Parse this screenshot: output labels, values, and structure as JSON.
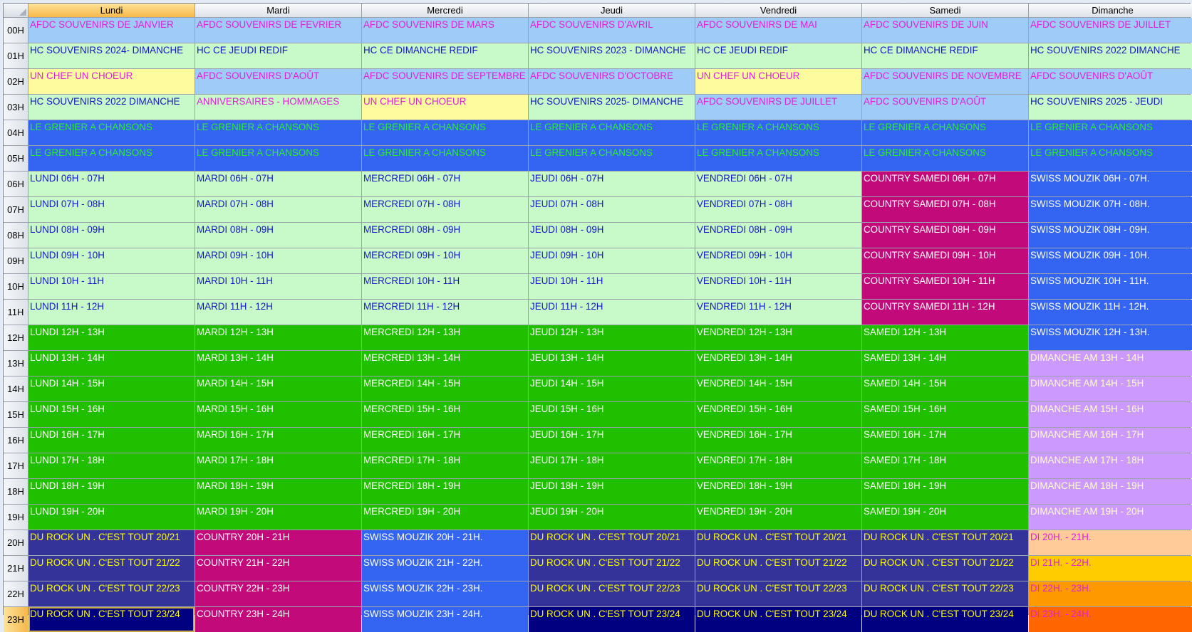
{
  "days": [
    "Lundi",
    "Mardi",
    "Mercredi",
    "Jeudi",
    "Vendredi",
    "Samedi",
    "Dimanche"
  ],
  "hours": [
    "00H",
    "01H",
    "02H",
    "03H",
    "04H",
    "05H",
    "06H",
    "07H",
    "08H",
    "09H",
    "10H",
    "11H",
    "12H",
    "13H",
    "14H",
    "15H",
    "16H",
    "17H",
    "18H",
    "19H",
    "20H",
    "21H",
    "22H",
    "23H"
  ],
  "selected": {
    "day": 0,
    "hour": 23
  },
  "styles": {
    "afdc": {
      "bg": "#9fcbf8",
      "fg": "#e020d8"
    },
    "hc": {
      "bg": "#c8f9c8",
      "fg": "#1616c8"
    },
    "hc_pink": {
      "bg": "#c8f9c8",
      "fg": "#e020d8"
    },
    "chef": {
      "bg": "#fdfb9e",
      "fg": "#e020d8"
    },
    "grenier": {
      "bg": "#3465f2",
      "fg": "#2cee2c"
    },
    "lightgreen": {
      "bg": "#c8f9c8",
      "fg": "#1616c8"
    },
    "green": {
      "bg": "#20c000",
      "fg": "#ffffff"
    },
    "country": {
      "bg": "#c30a7a",
      "fg": "#ffffff"
    },
    "swiss": {
      "bg": "#3465f2",
      "fg": "#ffffff"
    },
    "lavender": {
      "bg": "#cc99ff",
      "fg": "#ffffcc"
    },
    "rock": {
      "bg": "#333399",
      "fg": "#ffff00"
    },
    "rocknavy": {
      "bg": "#000080",
      "fg": "#ffff00"
    },
    "di20": {
      "bg": "#ffcc99",
      "fg": "#e020d8"
    },
    "di21": {
      "bg": "#ffcc00",
      "fg": "#e020d8"
    },
    "di22": {
      "bg": "#ff9900",
      "fg": "#e020d8"
    },
    "di23": {
      "bg": "#ff6600",
      "fg": "#e020d8"
    }
  },
  "rows": [
    [
      {
        "text": "AFDC SOUVENIRS DE JANVIER",
        "style": "afdc"
      },
      {
        "text": "AFDC SOUVENIRS DE FEVRIER",
        "style": "afdc"
      },
      {
        "text": "AFDC SOUVENIRS DE MARS",
        "style": "afdc"
      },
      {
        "text": "AFDC SOUVENIRS D'AVRIL",
        "style": "afdc"
      },
      {
        "text": "AFDC SOUVENIRS DE MAI",
        "style": "afdc"
      },
      {
        "text": "AFDC SOUVENIRS DE JUIN",
        "style": "afdc"
      },
      {
        "text": "AFDC SOUVENIRS DE JUILLET",
        "style": "afdc"
      }
    ],
    [
      {
        "text": "HC SOUVENIRS 2024- DIMANCHE",
        "style": "hc"
      },
      {
        "text": "HC CE JEUDI REDIF",
        "style": "hc"
      },
      {
        "text": "HC CE DIMANCHE REDIF",
        "style": "hc"
      },
      {
        "text": "HC SOUVENIRS 2023 - DIMANCHE",
        "style": "hc"
      },
      {
        "text": "HC CE JEUDI REDIF",
        "style": "hc"
      },
      {
        "text": "HC CE DIMANCHE REDIF",
        "style": "hc"
      },
      {
        "text": "HC SOUVENIRS 2022 DIMANCHE",
        "style": "hc"
      }
    ],
    [
      {
        "text": "UN CHEF UN CHOEUR",
        "style": "chef"
      },
      {
        "text": "AFDC SOUVENIRS D'AOÛT",
        "style": "afdc"
      },
      {
        "text": "AFDC SOUVENIRS DE SEPTEMBRE",
        "style": "afdc"
      },
      {
        "text": "AFDC SOUVENIRS D'OCTOBRE",
        "style": "afdc"
      },
      {
        "text": "UN CHEF UN CHOEUR",
        "style": "chef"
      },
      {
        "text": "AFDC SOUVENIRS DE NOVEMBRE",
        "style": "afdc"
      },
      {
        "text": "AFDC SOUVENIRS D'AOÛT",
        "style": "afdc"
      }
    ],
    [
      {
        "text": "HC SOUVENIRS 2022 DIMANCHE",
        "style": "hc"
      },
      {
        "text": "ANNIVERSAIRES - HOMMAGES",
        "style": "hc_pink"
      },
      {
        "text": "UN CHEF UN CHOEUR",
        "style": "chef"
      },
      {
        "text": "HC SOUVENIRS 2025- DIMANCHE",
        "style": "hc"
      },
      {
        "text": "AFDC SOUVENIRS DE JUILLET",
        "style": "afdc"
      },
      {
        "text": "AFDC SOUVENIRS D'AOÛT",
        "style": "afdc"
      },
      {
        "text": "HC SOUVENIRS 2025 - JEUDI",
        "style": "hc"
      }
    ],
    [
      {
        "text": "LE GRENIER A CHANSONS",
        "style": "grenier"
      },
      {
        "text": "LE GRENIER A CHANSONS",
        "style": "grenier"
      },
      {
        "text": "LE GRENIER A CHANSONS",
        "style": "grenier"
      },
      {
        "text": "LE GRENIER A CHANSONS",
        "style": "grenier"
      },
      {
        "text": "LE GRENIER A CHANSONS",
        "style": "grenier"
      },
      {
        "text": "LE GRENIER A CHANSONS",
        "style": "grenier"
      },
      {
        "text": "LE GRENIER A CHANSONS",
        "style": "grenier"
      }
    ],
    [
      {
        "text": "LE GRENIER A CHANSONS",
        "style": "grenier"
      },
      {
        "text": "LE GRENIER A CHANSONS",
        "style": "grenier"
      },
      {
        "text": "LE GRENIER A CHANSONS",
        "style": "grenier"
      },
      {
        "text": "LE GRENIER A CHANSONS",
        "style": "grenier"
      },
      {
        "text": "LE GRENIER A CHANSONS",
        "style": "grenier"
      },
      {
        "text": "LE GRENIER A CHANSONS",
        "style": "grenier"
      },
      {
        "text": "LE GRENIER A CHANSONS",
        "style": "grenier"
      }
    ],
    [
      {
        "text": "LUNDI 06H - 07H",
        "style": "lightgreen"
      },
      {
        "text": "MARDI 06H - 07H",
        "style": "lightgreen"
      },
      {
        "text": "MERCREDI 06H - 07H",
        "style": "lightgreen"
      },
      {
        "text": "JEUDI 06H - 07H",
        "style": "lightgreen"
      },
      {
        "text": "VENDREDI 06H - 07H",
        "style": "lightgreen"
      },
      {
        "text": "COUNTRY SAMEDI 06H - 07H",
        "style": "country"
      },
      {
        "text": "SWISS MOUZIK 06H - 07H.",
        "style": "swiss"
      }
    ],
    [
      {
        "text": "LUNDI 07H - 08H",
        "style": "lightgreen"
      },
      {
        "text": "MARDI 07H - 08H",
        "style": "lightgreen"
      },
      {
        "text": "MERCREDI 07H - 08H",
        "style": "lightgreen"
      },
      {
        "text": "JEUDI 07H - 08H",
        "style": "lightgreen"
      },
      {
        "text": "VENDREDI 07H - 08H",
        "style": "lightgreen"
      },
      {
        "text": "COUNTRY SAMEDI 07H - 08H",
        "style": "country"
      },
      {
        "text": "SWISS MOUZIK 07H - 08H.",
        "style": "swiss"
      }
    ],
    [
      {
        "text": "LUNDI 08H - 09H",
        "style": "lightgreen"
      },
      {
        "text": "MARDI 08H - 09H",
        "style": "lightgreen"
      },
      {
        "text": "MERCREDI 08H - 09H",
        "style": "lightgreen"
      },
      {
        "text": "JEUDI 08H - 09H",
        "style": "lightgreen"
      },
      {
        "text": "VENDREDI 08H - 09H",
        "style": "lightgreen"
      },
      {
        "text": "COUNTRY SAMEDI 08H - 09H",
        "style": "country"
      },
      {
        "text": "SWISS MOUZIK 08H - 09H.",
        "style": "swiss"
      }
    ],
    [
      {
        "text": "LUNDI 09H - 10H",
        "style": "lightgreen"
      },
      {
        "text": "MARDI 09H - 10H",
        "style": "lightgreen"
      },
      {
        "text": "MERCREDI 09H - 10H",
        "style": "lightgreen"
      },
      {
        "text": "JEUDI 09H - 10H",
        "style": "lightgreen"
      },
      {
        "text": "VENDREDI 09H - 10H",
        "style": "lightgreen"
      },
      {
        "text": "COUNTRY SAMEDI 09H - 10H",
        "style": "country"
      },
      {
        "text": "SWISS MOUZIK 09H - 10H.",
        "style": "swiss"
      }
    ],
    [
      {
        "text": "LUNDI 10H - 11H",
        "style": "lightgreen"
      },
      {
        "text": "MARDI 10H - 11H",
        "style": "lightgreen"
      },
      {
        "text": "MERCREDI 10H - 11H",
        "style": "lightgreen"
      },
      {
        "text": "JEUDI 10H - 11H",
        "style": "lightgreen"
      },
      {
        "text": "VENDREDI 10H - 11H",
        "style": "lightgreen"
      },
      {
        "text": "COUNTRY SAMEDI 10H - 11H",
        "style": "country"
      },
      {
        "text": "SWISS MOUZIK 10H - 11H.",
        "style": "swiss"
      }
    ],
    [
      {
        "text": "LUNDI 11H - 12H",
        "style": "lightgreen"
      },
      {
        "text": "MARDI 11H - 12H",
        "style": "lightgreen"
      },
      {
        "text": "MERCREDI 11H - 12H",
        "style": "lightgreen"
      },
      {
        "text": "JEUDI 11H - 12H",
        "style": "lightgreen"
      },
      {
        "text": "VENDREDI 11H - 12H",
        "style": "lightgreen"
      },
      {
        "text": "COUNTRY SAMEDI 11H - 12H",
        "style": "country"
      },
      {
        "text": "SWISS MOUZIK 11H - 12H.",
        "style": "swiss"
      }
    ],
    [
      {
        "text": "LUNDI 12H - 13H",
        "style": "green"
      },
      {
        "text": "MARDI 12H - 13H",
        "style": "green"
      },
      {
        "text": "MERCREDI 12H - 13H",
        "style": "green"
      },
      {
        "text": "JEUDI 12H - 13H",
        "style": "green"
      },
      {
        "text": "VENDREDI 12H - 13H",
        "style": "green"
      },
      {
        "text": "SAMEDI 12H - 13H",
        "style": "green"
      },
      {
        "text": "SWISS MOUZIK 12H - 13H.",
        "style": "swiss"
      }
    ],
    [
      {
        "text": "LUNDI 13H - 14H",
        "style": "green"
      },
      {
        "text": "MARDI 13H - 14H",
        "style": "green"
      },
      {
        "text": "MERCREDI 13H - 14H",
        "style": "green"
      },
      {
        "text": "JEUDI 13H - 14H",
        "style": "green"
      },
      {
        "text": "VENDREDI 13H - 14H",
        "style": "green"
      },
      {
        "text": "SAMEDI 13H - 14H",
        "style": "green"
      },
      {
        "text": "DIMANCHE AM 13H - 14H",
        "style": "lavender"
      }
    ],
    [
      {
        "text": "LUNDI 14H - 15H",
        "style": "green"
      },
      {
        "text": "MARDI 14H - 15H",
        "style": "green"
      },
      {
        "text": "MERCREDI 14H - 15H",
        "style": "green"
      },
      {
        "text": "JEUDI 14H - 15H",
        "style": "green"
      },
      {
        "text": "VENDREDI 14H - 15H",
        "style": "green"
      },
      {
        "text": "SAMEDI 14H - 15H",
        "style": "green"
      },
      {
        "text": "DIMANCHE AM 14H - 15H",
        "style": "lavender"
      }
    ],
    [
      {
        "text": "LUNDI 15H - 16H",
        "style": "green"
      },
      {
        "text": "MARDI 15H - 16H",
        "style": "green"
      },
      {
        "text": "MERCREDI 15H - 16H",
        "style": "green"
      },
      {
        "text": "JEUDI 15H - 16H",
        "style": "green"
      },
      {
        "text": "VENDREDI 15H - 16H",
        "style": "green"
      },
      {
        "text": "SAMEDI 15H - 16H",
        "style": "green"
      },
      {
        "text": "DIMANCHE AM 15H - 16H",
        "style": "lavender"
      }
    ],
    [
      {
        "text": "LUNDI 16H - 17H",
        "style": "green"
      },
      {
        "text": "MARDI 16H - 17H",
        "style": "green"
      },
      {
        "text": "MERCREDI 16H - 17H",
        "style": "green"
      },
      {
        "text": "JEUDI 16H - 17H",
        "style": "green"
      },
      {
        "text": "VENDREDI 16H - 17H",
        "style": "green"
      },
      {
        "text": "SAMEDI 16H - 17H",
        "style": "green"
      },
      {
        "text": "DIMANCHE AM 16H - 17H",
        "style": "lavender"
      }
    ],
    [
      {
        "text": "LUNDI 17H - 18H",
        "style": "green"
      },
      {
        "text": "MARDI 17H - 18H",
        "style": "green"
      },
      {
        "text": "MERCREDI 17H - 18H",
        "style": "green"
      },
      {
        "text": "JEUDI 17H - 18H",
        "style": "green"
      },
      {
        "text": "VENDREDI 17H - 18H",
        "style": "green"
      },
      {
        "text": "SAMEDI 17H - 18H",
        "style": "green"
      },
      {
        "text": "DIMANCHE AM 17H - 18H",
        "style": "lavender"
      }
    ],
    [
      {
        "text": "LUNDI 18H - 19H",
        "style": "green"
      },
      {
        "text": "MARDI 18H - 19H",
        "style": "green"
      },
      {
        "text": "MERCREDI 18H - 19H",
        "style": "green"
      },
      {
        "text": "JEUDI 18H - 19H",
        "style": "green"
      },
      {
        "text": "VENDREDI 18H - 19H",
        "style": "green"
      },
      {
        "text": "SAMEDI 18H - 19H",
        "style": "green"
      },
      {
        "text": "DIMANCHE AM 18H - 19H",
        "style": "lavender"
      }
    ],
    [
      {
        "text": "LUNDI 19H - 20H",
        "style": "green"
      },
      {
        "text": "MARDI 19H - 20H",
        "style": "green"
      },
      {
        "text": "MERCREDI 19H - 20H",
        "style": "green"
      },
      {
        "text": "JEUDI 19H - 20H",
        "style": "green"
      },
      {
        "text": "VENDREDI 19H - 20H",
        "style": "green"
      },
      {
        "text": "SAMEDI 19H - 20H",
        "style": "green"
      },
      {
        "text": "DIMANCHE AM 19H - 20H",
        "style": "lavender"
      }
    ],
    [
      {
        "text": "DU ROCK UN . C'EST TOUT 20/21",
        "style": "rock"
      },
      {
        "text": "COUNTRY 20H - 21H",
        "style": "country"
      },
      {
        "text": "SWISS MOUZIK 20H - 21H.",
        "style": "swiss"
      },
      {
        "text": "DU ROCK UN . C'EST TOUT 20/21",
        "style": "rock"
      },
      {
        "text": "DU ROCK UN . C'EST TOUT 20/21",
        "style": "rock"
      },
      {
        "text": "DU ROCK UN . C'EST TOUT 20/21",
        "style": "rock"
      },
      {
        "text": "DI 20H. - 21H.",
        "style": "di20"
      }
    ],
    [
      {
        "text": "DU ROCK UN . C'EST TOUT 21/22",
        "style": "rock"
      },
      {
        "text": "COUNTRY 21H - 22H",
        "style": "country"
      },
      {
        "text": "SWISS MOUZIK 21H - 22H.",
        "style": "swiss"
      },
      {
        "text": "DU ROCK UN . C'EST TOUT 21/22",
        "style": "rock"
      },
      {
        "text": "DU ROCK UN . C'EST TOUT 21/22",
        "style": "rock"
      },
      {
        "text": "DU ROCK UN . C'EST TOUT 21/22",
        "style": "rock"
      },
      {
        "text": "DI 21H. - 22H.",
        "style": "di21"
      }
    ],
    [
      {
        "text": "DU ROCK UN . C'EST TOUT 22/23",
        "style": "rock"
      },
      {
        "text": "COUNTRY 22H - 23H",
        "style": "country"
      },
      {
        "text": "SWISS MOUZIK 22H - 23H.",
        "style": "swiss"
      },
      {
        "text": "DU ROCK UN . C'EST TOUT 22/23",
        "style": "rock"
      },
      {
        "text": "DU ROCK UN . C'EST TOUT 22/23",
        "style": "rock"
      },
      {
        "text": "DU ROCK UN . C'EST TOUT 22/23",
        "style": "rock"
      },
      {
        "text": "DI 22H. - 23H.",
        "style": "di22"
      }
    ],
    [
      {
        "text": "DU ROCK UN . C'EST TOUT 23/24",
        "style": "rocknavy"
      },
      {
        "text": "COUNTRY 23H - 24H",
        "style": "country"
      },
      {
        "text": "SWISS MOUZIK 23H - 24H.",
        "style": "swiss"
      },
      {
        "text": "DU ROCK UN . C'EST TOUT 23/24",
        "style": "rocknavy"
      },
      {
        "text": "DU ROCK UN . C'EST TOUT 23/24",
        "style": "rocknavy"
      },
      {
        "text": "DU ROCK UN . C'EST TOUT 23/24",
        "style": "rocknavy"
      },
      {
        "text": "DI 23H. - 24H.",
        "style": "di23"
      }
    ]
  ]
}
